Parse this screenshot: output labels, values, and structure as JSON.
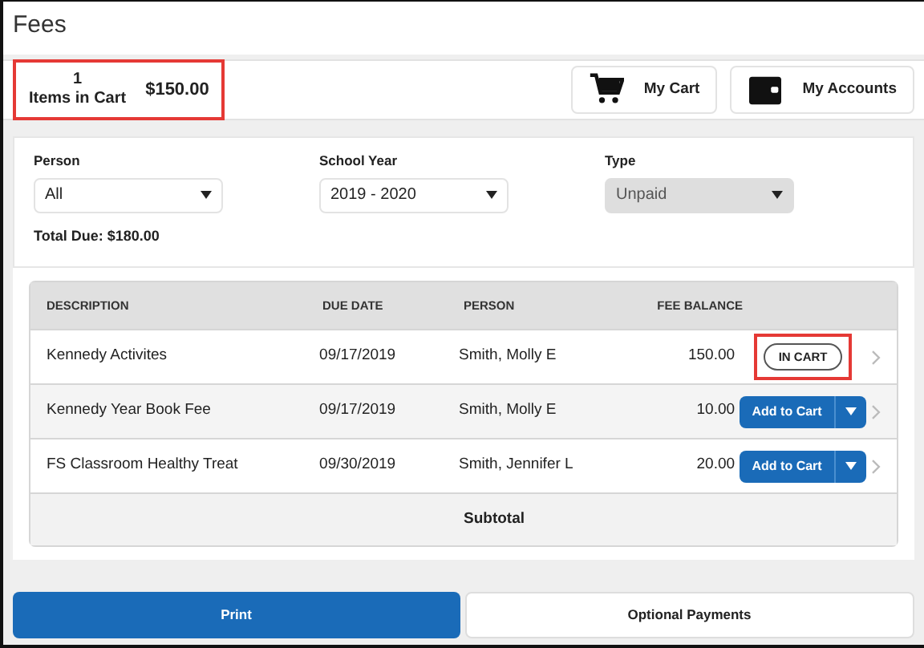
{
  "page_title": "Fees",
  "cart_summary": {
    "count": "1",
    "count_label": "Items in Cart",
    "amount": "$150.00",
    "highlighted": true
  },
  "header_buttons": [
    {
      "label": "My Cart",
      "kind": "cart"
    },
    {
      "label": "My Accounts",
      "kind": "wallet"
    }
  ],
  "filters": [
    {
      "label": "Person",
      "value": "All",
      "disabled": false
    },
    {
      "label": "School Year",
      "value": "2019 - 2020",
      "disabled": false
    },
    {
      "label": "Type",
      "value": "Unpaid",
      "disabled": true
    }
  ],
  "total_due": "Total Due: $180.00",
  "table": {
    "columns": [
      "DESCRIPTION",
      "DUE DATE",
      "PERSON",
      "FEE BALANCE"
    ],
    "rows": [
      {
        "description": "Kennedy Activites",
        "due_date": "09/17/2019",
        "person": "Smith, Molly E",
        "balance": "150.00",
        "kind": "in_cart",
        "action": "IN CART",
        "highlighted": true
      },
      {
        "description": "Kennedy Year Book Fee",
        "due_date": "09/17/2019",
        "person": "Smith, Molly E",
        "balance": "10.00",
        "kind": "add",
        "action": "Add to Cart",
        "highlighted": false
      },
      {
        "description": "FS Classroom Healthy Treat",
        "due_date": "09/30/2019",
        "person": "Smith, Jennifer L",
        "balance": "20.00",
        "kind": "add",
        "action": "Add to Cart",
        "highlighted": false
      }
    ],
    "subtotal": "Subtotal"
  },
  "footer_buttons": [
    {
      "label": "Print",
      "primary": true
    },
    {
      "label": "Optional Payments",
      "primary": false
    }
  ]
}
